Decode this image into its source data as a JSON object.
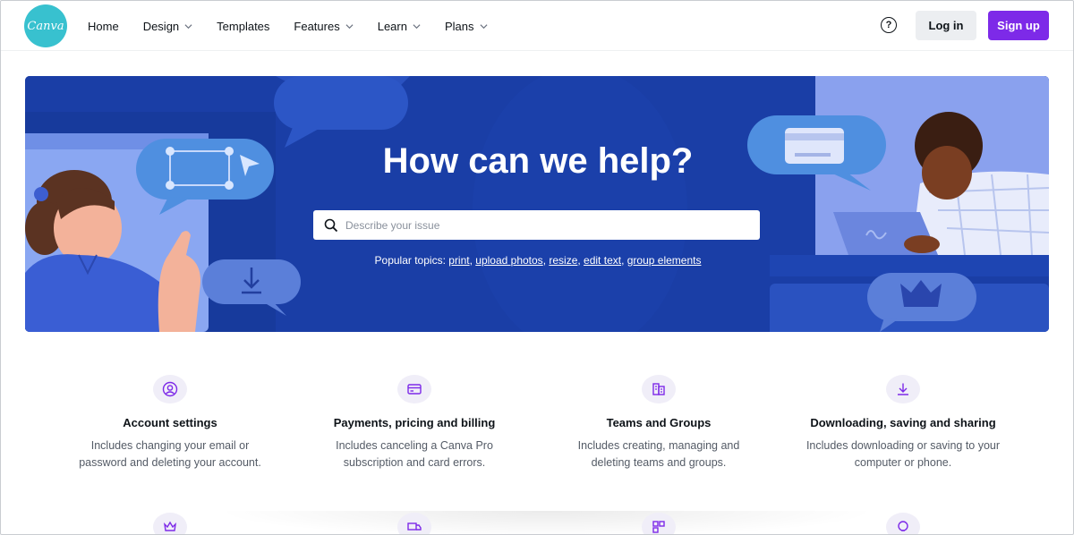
{
  "brand": {
    "logo_text": "Canva",
    "logo_color": "#38c1cf",
    "accent": "#7d2ae8"
  },
  "nav": {
    "items": [
      {
        "label": "Home",
        "has_dropdown": false
      },
      {
        "label": "Design",
        "has_dropdown": true
      },
      {
        "label": "Templates",
        "has_dropdown": false
      },
      {
        "label": "Features",
        "has_dropdown": true
      },
      {
        "label": "Learn",
        "has_dropdown": true
      },
      {
        "label": "Plans",
        "has_dropdown": true
      }
    ],
    "help_icon": "question-circle-icon",
    "login_label": "Log in",
    "signup_label": "Sign up"
  },
  "hero": {
    "title": "How can we help?",
    "search_placeholder": "Describe your issue",
    "topics_label": "Popular topics:",
    "topics": [
      "print",
      "upload photos",
      "resize",
      "edit text",
      "group elements"
    ],
    "background": "#1c3fa8"
  },
  "categories": [
    {
      "icon": "user-circle-icon",
      "title": "Account settings",
      "desc_line1": "Includes changing your email or",
      "desc_line2": "password and deleting your account."
    },
    {
      "icon": "credit-card-icon",
      "title": "Payments, pricing and billing",
      "desc_line1": "Includes canceling a Canva Pro",
      "desc_line2": "subscription and card errors."
    },
    {
      "icon": "team-icon",
      "title": "Teams and Groups",
      "desc_line1": "Includes creating, managing and",
      "desc_line2": "deleting teams and groups."
    },
    {
      "icon": "download-icon",
      "title": "Downloading, saving and sharing",
      "desc_line1": "Includes downloading or saving to your",
      "desc_line2": "computer or phone."
    }
  ],
  "more_category_icons": [
    "crown-icon",
    "truck-icon",
    "grid-icon",
    "lightbulb-icon"
  ]
}
